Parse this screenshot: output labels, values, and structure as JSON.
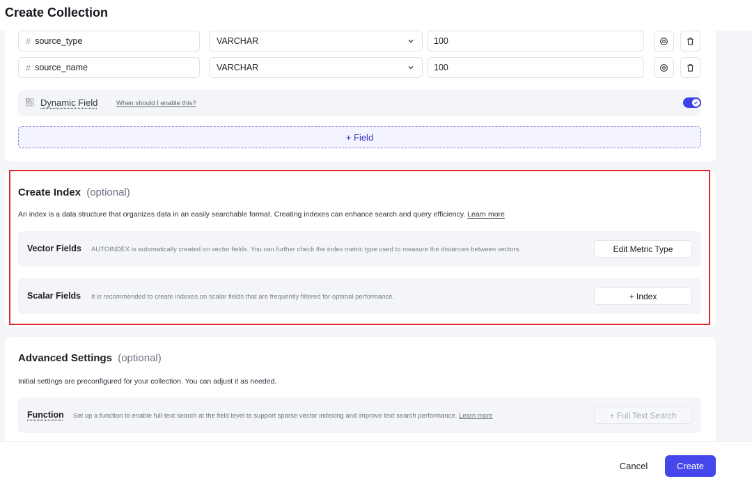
{
  "header": {
    "title": "Create Collection"
  },
  "fields": [
    {
      "name": "source_type",
      "type": "VARCHAR",
      "max_length": "100"
    },
    {
      "name": "source_name",
      "type": "VARCHAR",
      "max_length": "100"
    }
  ],
  "dynamic_field": {
    "label": "Dynamic Field",
    "help_link": "When should I enable this?",
    "enabled": true
  },
  "add_field_button": "+ Field",
  "create_index": {
    "title": "Create Index",
    "optional": "(optional)",
    "description": "An index is a data structure that organizes data in an easily searchable format. Creating indexes can enhance search and query efficiency.",
    "learn_more": "Learn more",
    "vector_fields": {
      "label": "Vector Fields",
      "description": "AUTOINDEX is automatically created on vector fields. You can further check the index metric type used to measure the distances between vectors.",
      "button": "Edit Metric Type"
    },
    "scalar_fields": {
      "label": "Scalar Fields",
      "description": "It is recommended to create indexes on scalar fields that are frequently filtered for optimal performance.",
      "button": "+ Index"
    }
  },
  "advanced_settings": {
    "title": "Advanced Settings",
    "optional": "(optional)",
    "description": "Initial settings are preconfigured for your collection. You can adjust it as needed.",
    "function": {
      "label": "Function",
      "description": "Set up a function to enable full-text search at the field level to support sparse vector indexing and improve text search performance.",
      "learn_more": "Learn more",
      "button": "+ Full Text Search"
    }
  },
  "footer": {
    "cancel": "Cancel",
    "create": "Create"
  },
  "colors": {
    "primary": "#4547ea",
    "highlight_border": "#e0282e"
  }
}
